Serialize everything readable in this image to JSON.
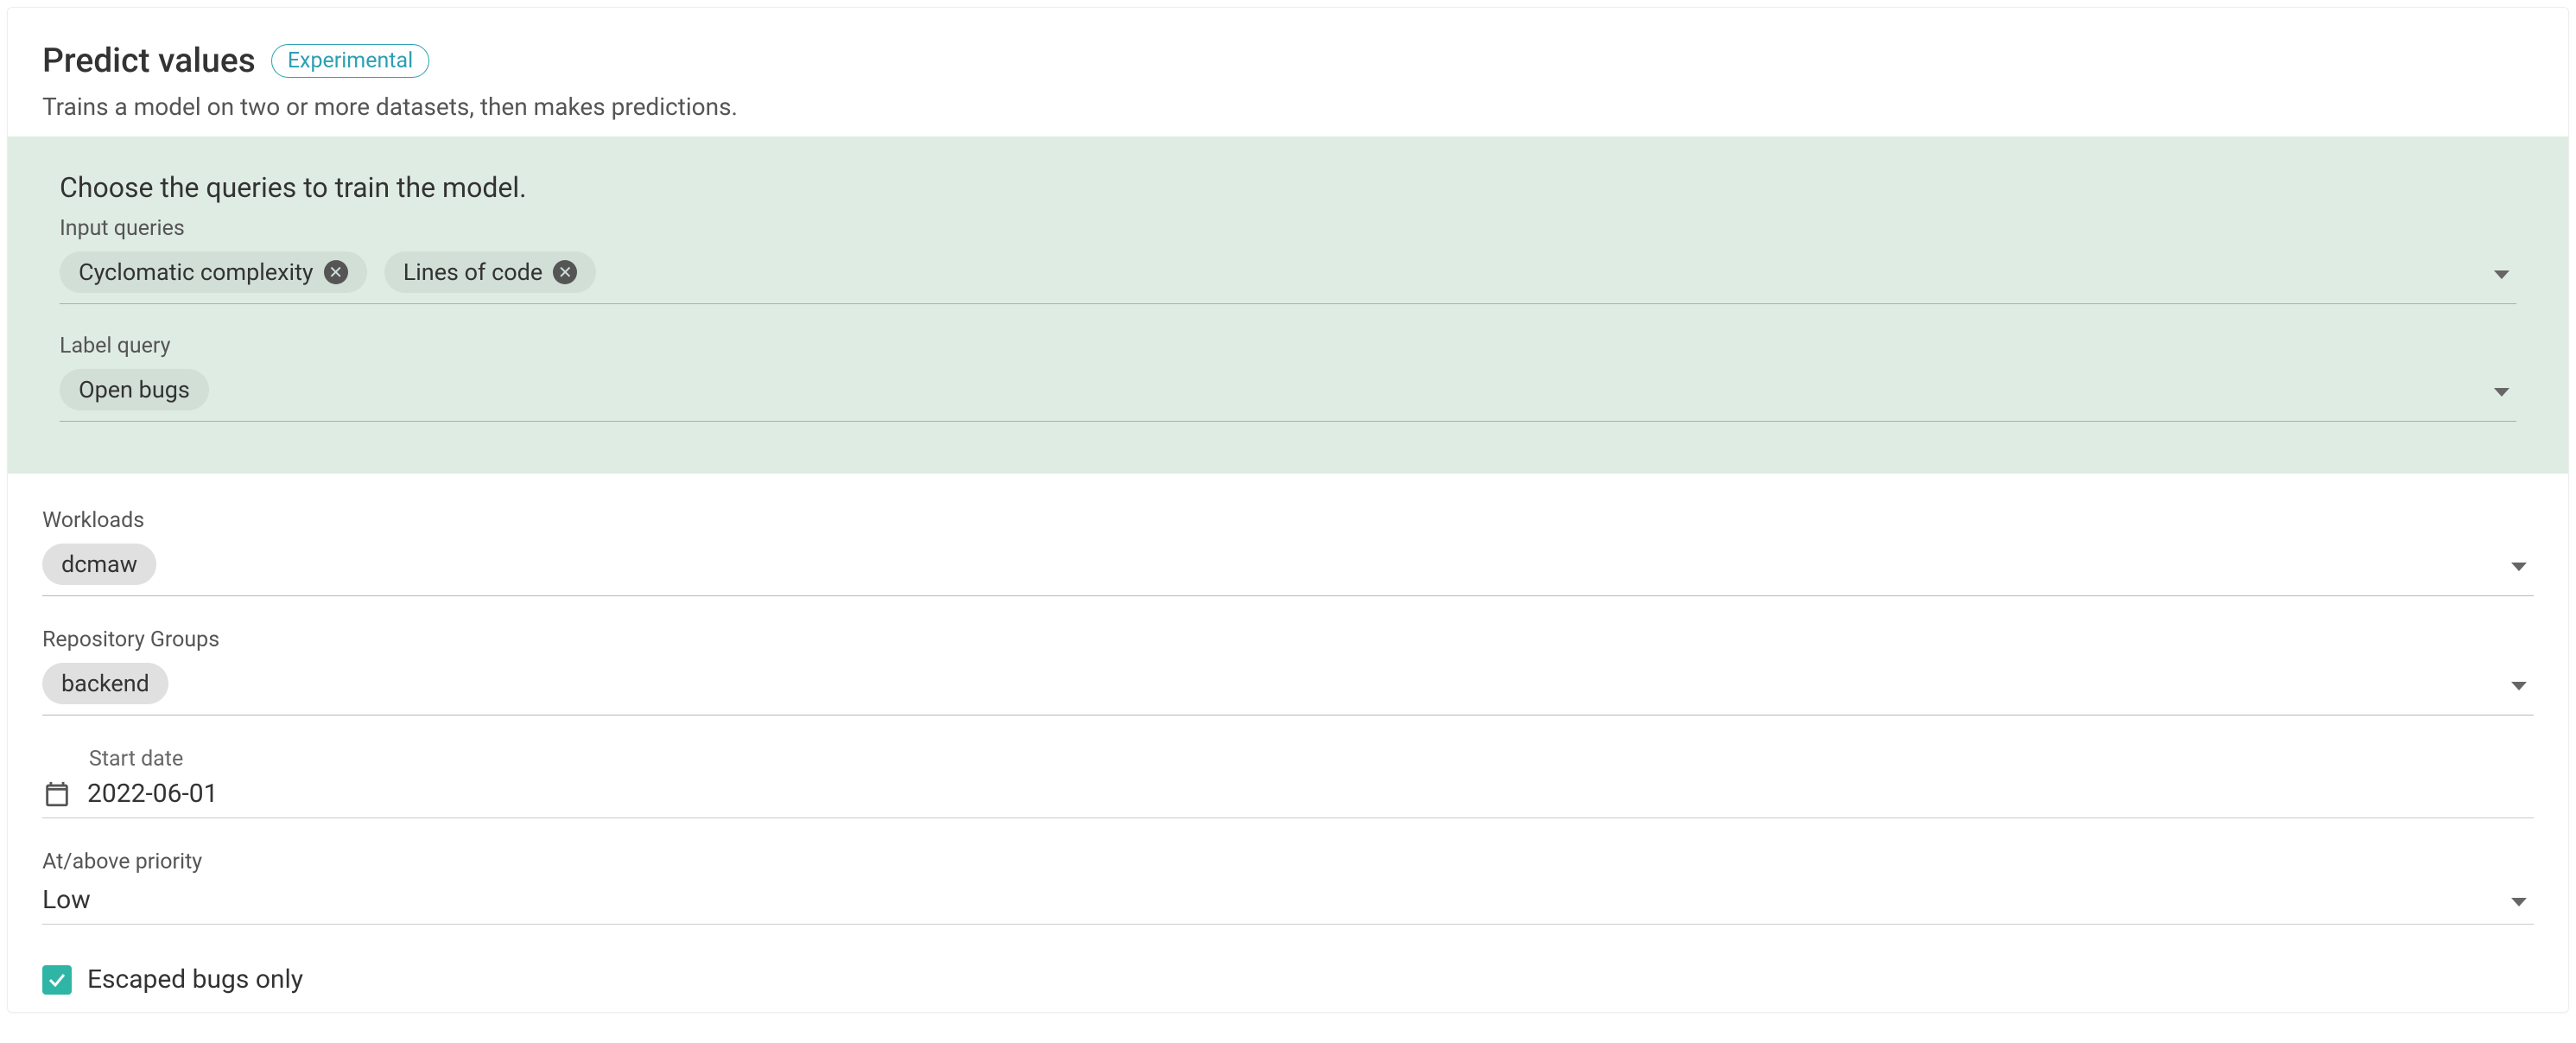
{
  "header": {
    "title": "Predict values",
    "badge": "Experimental",
    "subtitle": "Trains a model on two or more datasets, then makes predictions."
  },
  "training": {
    "heading": "Choose the queries to train the model.",
    "input_queries_label": "Input queries",
    "input_queries": [
      {
        "label": "Cyclomatic complexity"
      },
      {
        "label": "Lines of code"
      }
    ],
    "label_query_label": "Label query",
    "label_query": [
      {
        "label": "Open bugs"
      }
    ]
  },
  "filters": {
    "workloads_label": "Workloads",
    "workloads": [
      {
        "label": "dcmaw"
      }
    ],
    "repo_groups_label": "Repository Groups",
    "repo_groups": [
      {
        "label": "backend"
      }
    ],
    "start_date_label": "Start date",
    "start_date_value": "2022-06-01",
    "priority_label": "At/above priority",
    "priority_value": "Low",
    "escaped_bugs_label": "Escaped bugs only",
    "escaped_bugs_checked": true
  }
}
